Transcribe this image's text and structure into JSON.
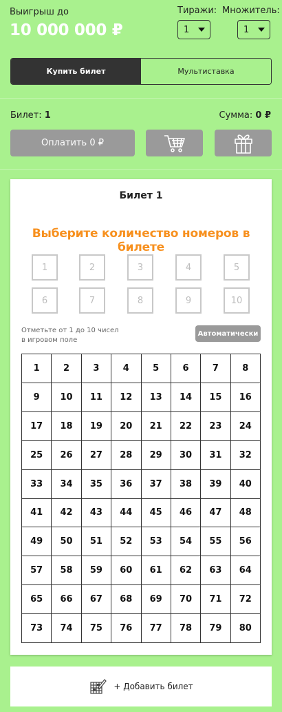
{
  "header": {
    "prize_label": "Выигрыш до",
    "prize_value": "10 000 000 ₽",
    "draws_label": "Тиражи:",
    "draws_value": "1",
    "multiplier_label": "Множитель:",
    "multiplier_value": "1"
  },
  "tabs": [
    {
      "label": "Купить билет",
      "active": true
    },
    {
      "label": "Мультиставка",
      "active": false
    }
  ],
  "summary": {
    "ticket_label": "Билет:",
    "ticket_count": "1",
    "sum_label": "Сумма:",
    "sum_value": "0 ₽",
    "pay_button": "Оплатить 0 ₽"
  },
  "card": {
    "title": "Билет 1",
    "heading": "Выберите количество номеров в билете",
    "counts": [
      "1",
      "2",
      "3",
      "4",
      "5",
      "6",
      "7",
      "8",
      "9",
      "10"
    ],
    "hint_line1": "Отметьте от 1 до 10 чисел",
    "hint_line2": "в игровом поле",
    "auto_button": "Автоматически",
    "numbers": [
      "1",
      "2",
      "3",
      "4",
      "5",
      "6",
      "7",
      "8",
      "9",
      "10",
      "11",
      "12",
      "13",
      "14",
      "15",
      "16",
      "17",
      "18",
      "19",
      "20",
      "21",
      "22",
      "23",
      "24",
      "25",
      "26",
      "27",
      "28",
      "29",
      "30",
      "31",
      "32",
      "33",
      "34",
      "35",
      "36",
      "37",
      "38",
      "39",
      "40",
      "41",
      "42",
      "43",
      "44",
      "45",
      "46",
      "47",
      "48",
      "49",
      "50",
      "51",
      "52",
      "53",
      "54",
      "55",
      "56",
      "57",
      "58",
      "59",
      "60",
      "61",
      "62",
      "63",
      "64",
      "65",
      "66",
      "67",
      "68",
      "69",
      "70",
      "71",
      "72",
      "73",
      "74",
      "75",
      "76",
      "77",
      "78",
      "79",
      "80"
    ]
  },
  "add_ticket": {
    "label": "+ Добавить билет",
    "icon": "ticket-pen-icon"
  },
  "colors": {
    "background": "#a9f18e",
    "accent": "#f7901e",
    "active_tab": "#333333",
    "button_gray": "#9a9a9a"
  }
}
